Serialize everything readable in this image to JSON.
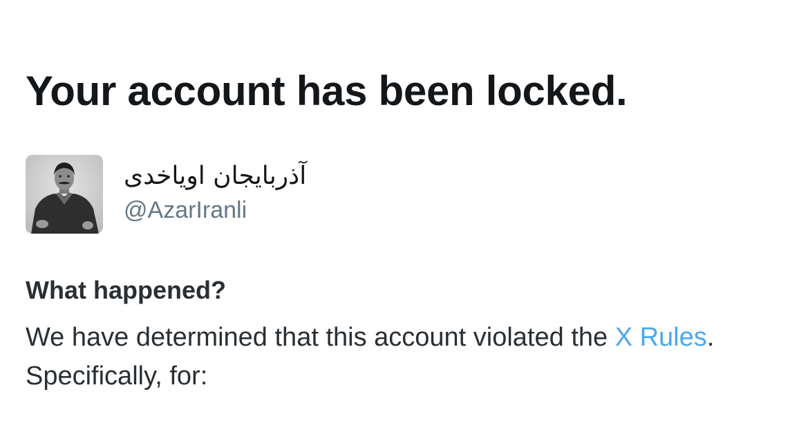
{
  "heading": {
    "title": "Your account has been locked."
  },
  "account": {
    "display_name": "آذربایجان اویاخدی",
    "handle": "@AzarIranli",
    "avatar_icon": "profile-photo"
  },
  "what_happened": {
    "heading": "What happened?",
    "text_before": "We have determined that this account violated the ",
    "link_label": "X Rules",
    "text_after": ". Specifically, for:"
  },
  "colors": {
    "text": "#14171a",
    "secondary_text": "#657786",
    "link": "#4aa8ec",
    "background": "#ffffff"
  }
}
